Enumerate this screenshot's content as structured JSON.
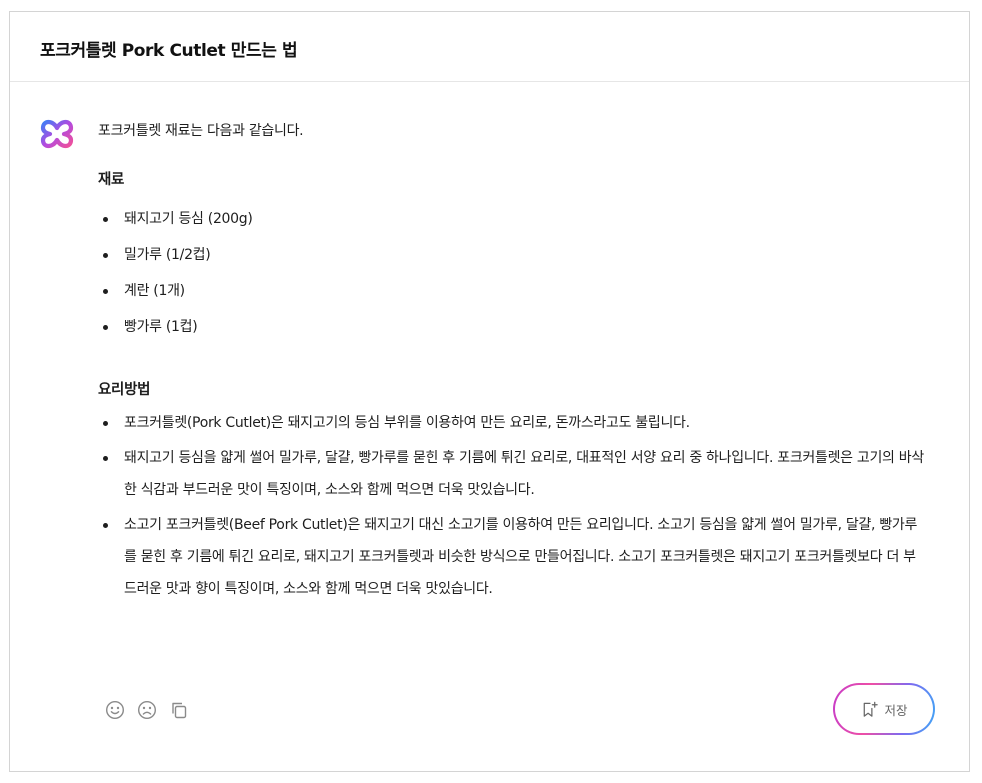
{
  "header": {
    "title": "포크커틀렛 Pork Cutlet 만드는 법"
  },
  "message": {
    "intro": "포크커틀렛 재료는 다음과 같습니다.",
    "ingredients": {
      "heading": "재료",
      "items": [
        "돼지고기 등심 (200g)",
        "밀가루 (1/2컵)",
        "계란 (1개)",
        "빵가루 (1컵)"
      ]
    },
    "method": {
      "heading": "요리방법",
      "steps": [
        "포크커틀렛(Pork Cutlet)은 돼지고기의 등심 부위를 이용하여 만든 요리로, 돈까스라고도 불립니다.",
        "돼지고기 등심을 얇게 썰어 밀가루, 달걀, 빵가루를 묻힌 후 기름에 튀긴 요리로, 대표적인 서양 요리 중 하나입니다. 포크커틀렛은 고기의 바삭한 식감과 부드러운 맛이 특징이며, 소스와 함께 먹으면 더욱 맛있습니다.",
        "소고기 포크커틀렛(Beef Pork Cutlet)은 돼지고기 대신 소고기를 이용하여 만든 요리입니다. 소고기 등심을 얇게 썰어 밀가루, 달걀, 빵가루를 묻힌 후 기름에 튀긴 요리로, 돼지고기 포크커틀렛과 비슷한 방식으로 만들어집니다. 소고기 포크커틀렛은 돼지고기 포크커틀렛보다 더 부드러운 맛과 향이 특징이며, 소스와 함께 먹으면 더욱 맛있습니다."
      ]
    }
  },
  "actions": {
    "icons": [
      "smile-icon",
      "frown-icon",
      "copy-icon"
    ],
    "save_label": "저장",
    "save_icon": "bookmark-add-icon"
  },
  "colors": {
    "logo_gradient": [
      "#3f7df5",
      "#b14be0",
      "#f0509a"
    ],
    "save_border_gradient": [
      "#c63cc9",
      "#ee4fa6",
      "#7d6af0",
      "#3fa6f5"
    ]
  }
}
